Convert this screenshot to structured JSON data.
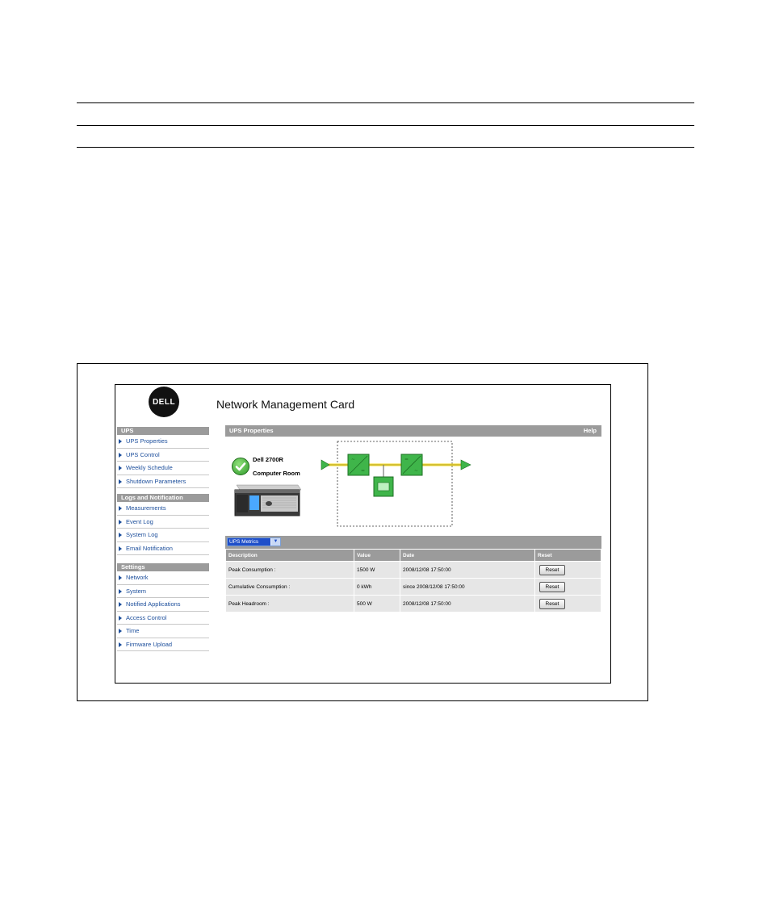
{
  "app": {
    "title": "Network Management Card",
    "logo_text": "DELL"
  },
  "sidebar": {
    "sections": [
      {
        "title": "UPS",
        "items": [
          "UPS Properties",
          "UPS Control",
          "Weekly Schedule",
          "Shutdown Parameters"
        ]
      },
      {
        "title": "Logs and Notification",
        "items": [
          "Measurements",
          "Event Log",
          "System Log",
          "Email Notification"
        ]
      },
      {
        "title": "Settings",
        "items": [
          "Network",
          "System",
          "Notified Applications",
          "Access Control",
          "Time",
          "Firmware Upload"
        ]
      }
    ]
  },
  "main": {
    "panel_title": "UPS Properties",
    "help_label": "Help",
    "status": {
      "model": "Dell 2700R",
      "location": "Computer Room",
      "icon": "check-circle-icon"
    },
    "select": {
      "value": "UPS Metrics"
    },
    "table": {
      "headers": [
        "Description",
        "Value",
        "Date",
        "Reset"
      ],
      "rows": [
        {
          "description": "Peak Consumption :",
          "value": "1500 W",
          "date": "2008/12/08 17:50:00",
          "action": "Reset"
        },
        {
          "description": "Cumulative Consumption :",
          "value": "0 kWh",
          "date": "since 2008/12/08 17:50:00",
          "action": "Reset"
        },
        {
          "description": "Peak Headroom :",
          "value": "500 W",
          "date": "2008/12/08 17:50:00",
          "action": "Reset"
        }
      ]
    }
  },
  "colors": {
    "header_gray": "#9b9b9b",
    "link_blue": "#1d4f9c",
    "diagram_green": "#3fb54a",
    "flow_yellow": "#f4d81c"
  }
}
